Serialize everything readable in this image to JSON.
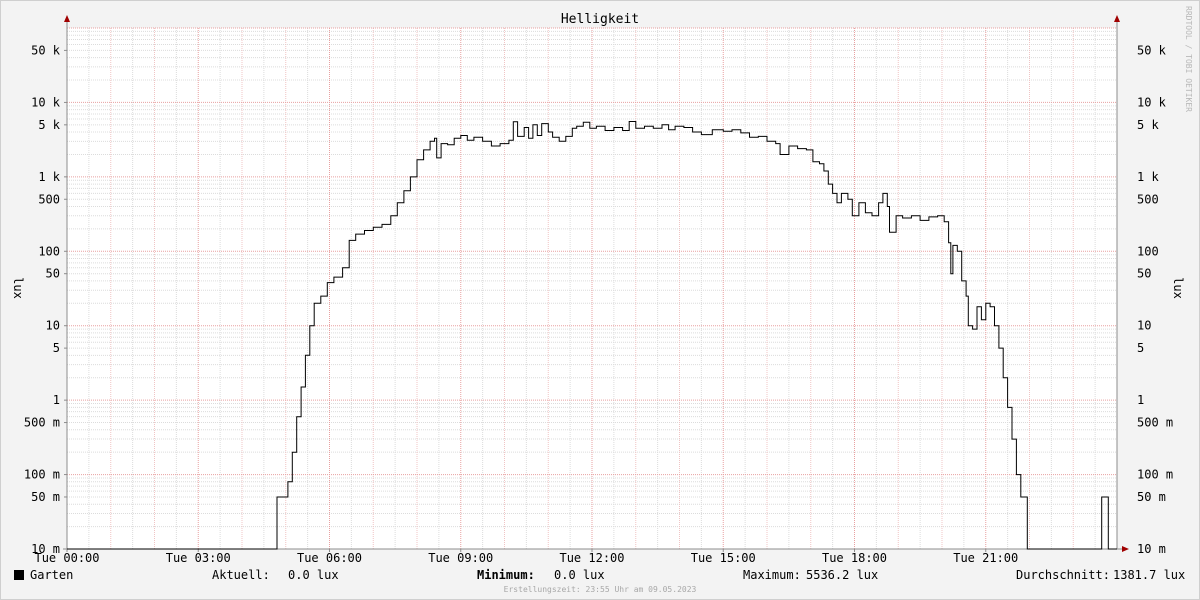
{
  "chart_data": {
    "type": "line",
    "title": "Helligkeit",
    "ylabel": "lux",
    "y_scale": "log",
    "ylim": [
      0.01,
      100000
    ],
    "xlim": [
      0,
      24
    ],
    "x_unit": "hours",
    "grid": true,
    "watermark": "RRDTOOL / TOBI OETIKER",
    "y_ticks": [
      {
        "value": 50000,
        "label": "50 k"
      },
      {
        "value": 10000,
        "label": "10 k"
      },
      {
        "value": 5000,
        "label": "5 k"
      },
      {
        "value": 1000,
        "label": "1 k"
      },
      {
        "value": 500,
        "label": "500"
      },
      {
        "value": 100,
        "label": "100"
      },
      {
        "value": 50,
        "label": "50"
      },
      {
        "value": 10,
        "label": "10"
      },
      {
        "value": 5,
        "label": "5"
      },
      {
        "value": 1,
        "label": "1"
      },
      {
        "value": 0.5,
        "label": "500 m"
      },
      {
        "value": 0.1,
        "label": "100 m"
      },
      {
        "value": 0.05,
        "label": "50 m"
      },
      {
        "value": 0.01,
        "label": "10 m"
      }
    ],
    "x_ticks": [
      {
        "value": 0,
        "label": "Tue 00:00"
      },
      {
        "value": 3,
        "label": "Tue 03:00"
      },
      {
        "value": 6,
        "label": "Tue 06:00"
      },
      {
        "value": 9,
        "label": "Tue 09:00"
      },
      {
        "value": 12,
        "label": "Tue 12:00"
      },
      {
        "value": 15,
        "label": "Tue 15:00"
      },
      {
        "value": 18,
        "label": "Tue 18:00"
      },
      {
        "value": 21,
        "label": "Tue 21:00"
      }
    ],
    "series": [
      {
        "name": "Garten",
        "color": "#000000",
        "points": [
          [
            0,
            0.01
          ],
          [
            4.8,
            0.01
          ],
          [
            4.8,
            0.05
          ],
          [
            5.0,
            0.05
          ],
          [
            5.05,
            0.08
          ],
          [
            5.15,
            0.2
          ],
          [
            5.25,
            0.6
          ],
          [
            5.35,
            1.5
          ],
          [
            5.45,
            4
          ],
          [
            5.55,
            10
          ],
          [
            5.65,
            20
          ],
          [
            5.8,
            25
          ],
          [
            5.95,
            38
          ],
          [
            6.1,
            45
          ],
          [
            6.3,
            60
          ],
          [
            6.45,
            140
          ],
          [
            6.6,
            170
          ],
          [
            6.8,
            190
          ],
          [
            7.0,
            210
          ],
          [
            7.2,
            230
          ],
          [
            7.4,
            300
          ],
          [
            7.55,
            450
          ],
          [
            7.7,
            650
          ],
          [
            7.85,
            1000
          ],
          [
            8.0,
            1700
          ],
          [
            8.15,
            2300
          ],
          [
            8.3,
            3000
          ],
          [
            8.4,
            3300
          ],
          [
            8.45,
            1800
          ],
          [
            8.55,
            2800
          ],
          [
            8.7,
            2700
          ],
          [
            8.85,
            3300
          ],
          [
            9.0,
            3600
          ],
          [
            9.15,
            3100
          ],
          [
            9.3,
            3400
          ],
          [
            9.5,
            3000
          ],
          [
            9.7,
            2600
          ],
          [
            9.9,
            2800
          ],
          [
            10.1,
            3100
          ],
          [
            10.2,
            5500
          ],
          [
            10.3,
            3500
          ],
          [
            10.45,
            4600
          ],
          [
            10.55,
            3300
          ],
          [
            10.65,
            5000
          ],
          [
            10.75,
            3600
          ],
          [
            10.85,
            5200
          ],
          [
            11.0,
            4000
          ],
          [
            11.1,
            3400
          ],
          [
            11.25,
            3000
          ],
          [
            11.4,
            3500
          ],
          [
            11.55,
            4500
          ],
          [
            11.65,
            4800
          ],
          [
            11.8,
            5400
          ],
          [
            11.95,
            4500
          ],
          [
            12.1,
            4800
          ],
          [
            12.3,
            4200
          ],
          [
            12.5,
            4600
          ],
          [
            12.7,
            4200
          ],
          [
            12.85,
            5536.2
          ],
          [
            13.0,
            4500
          ],
          [
            13.2,
            4800
          ],
          [
            13.4,
            4500
          ],
          [
            13.6,
            5000
          ],
          [
            13.75,
            4300
          ],
          [
            13.9,
            4800
          ],
          [
            14.1,
            4600
          ],
          [
            14.3,
            4000
          ],
          [
            14.5,
            3700
          ],
          [
            14.75,
            4300
          ],
          [
            15.0,
            4100
          ],
          [
            15.2,
            4300
          ],
          [
            15.4,
            3900
          ],
          [
            15.6,
            3400
          ],
          [
            15.8,
            3500
          ],
          [
            16.0,
            3000
          ],
          [
            16.2,
            2800
          ],
          [
            16.3,
            2000
          ],
          [
            16.5,
            2600
          ],
          [
            16.7,
            2400
          ],
          [
            16.9,
            2300
          ],
          [
            17.05,
            1600
          ],
          [
            17.2,
            1500
          ],
          [
            17.3,
            1200
          ],
          [
            17.4,
            800
          ],
          [
            17.5,
            600
          ],
          [
            17.6,
            450
          ],
          [
            17.7,
            600
          ],
          [
            17.85,
            500
          ],
          [
            17.95,
            300
          ],
          [
            18.1,
            450
          ],
          [
            18.25,
            330
          ],
          [
            18.4,
            300
          ],
          [
            18.55,
            450
          ],
          [
            18.65,
            600
          ],
          [
            18.75,
            400
          ],
          [
            18.8,
            180
          ],
          [
            18.95,
            300
          ],
          [
            19.1,
            280
          ],
          [
            19.3,
            300
          ],
          [
            19.5,
            260
          ],
          [
            19.7,
            290
          ],
          [
            19.9,
            300
          ],
          [
            20.05,
            250
          ],
          [
            20.15,
            130
          ],
          [
            20.2,
            50
          ],
          [
            20.25,
            120
          ],
          [
            20.35,
            100
          ],
          [
            20.45,
            40
          ],
          [
            20.55,
            25
          ],
          [
            20.6,
            10
          ],
          [
            20.7,
            9
          ],
          [
            20.8,
            18
          ],
          [
            20.9,
            12
          ],
          [
            21.0,
            20
          ],
          [
            21.1,
            18
          ],
          [
            21.2,
            10
          ],
          [
            21.3,
            5
          ],
          [
            21.4,
            2
          ],
          [
            21.5,
            0.8
          ],
          [
            21.6,
            0.3
          ],
          [
            21.7,
            0.1
          ],
          [
            21.8,
            0.05
          ],
          [
            21.9,
            0.05
          ],
          [
            21.95,
            0.01
          ],
          [
            23.65,
            0.01
          ],
          [
            23.65,
            0.05
          ],
          [
            23.8,
            0.05
          ],
          [
            23.8,
            0.01
          ],
          [
            24.0,
            0.01
          ]
        ]
      }
    ]
  },
  "legend": {
    "series_name": "Garten",
    "current_label": "Aktuell:",
    "current_value": "0.0 lux",
    "minimum_label": "Minimum:",
    "minimum_value": "0.0 lux",
    "maximum_label": "Maximum:",
    "maximum_value": "5536.2 lux",
    "average_label": "Durchschnitt:",
    "average_value": "1381.7 lux"
  },
  "footer": {
    "creation_text": "Erstellungszeit: 23:55 Uhr am 09.05.2023"
  }
}
